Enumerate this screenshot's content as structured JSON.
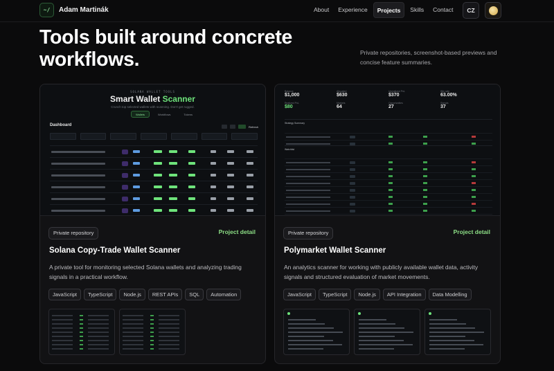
{
  "nav": {
    "logo": "~/",
    "brand": "Adam Martinák",
    "links": [
      "About",
      "Experience",
      "Projects",
      "Skills",
      "Contact"
    ],
    "active": "Projects",
    "lang": "CZ",
    "theme_icon": "moon-icon"
  },
  "hero": {
    "title": "Tools built around concrete workflows.",
    "description": "Private repositories, screenshot-based previews and concise feature summaries."
  },
  "projects": [
    {
      "badge": "Private repository",
      "detail": "Project detail",
      "title": "Solana Copy-Trade Wallet Scanner",
      "description": "A private tool for monitoring selected Solana wallets and analyzing trading signals in a practical workflow.",
      "tags": [
        "JavaScript",
        "TypeScript",
        "Node.js",
        "REST APIs",
        "SQL",
        "Automation"
      ],
      "preview": {
        "kicker": "SOLANA WALLET TOOLS",
        "title_main": "Smart Wallet ",
        "title_accent": "Scanner",
        "subtitle": "Crunch top selected wallets with scanning. Don't get rugged.",
        "tabs": [
          "Wallets",
          "Workflows",
          "Tokens"
        ],
        "dashboard": "Dashboard",
        "refresh": "Refresh"
      }
    },
    {
      "badge": "Private repository",
      "detail": "Project detail",
      "title": "Polymarket Wallet Scanner",
      "description": "An analytics scanner for working with publicly available wallet data, activity signals and structured evaluation of market movements.",
      "tags": [
        "JavaScript",
        "TypeScript",
        "Node.js",
        "API Integration",
        "Data Modelling"
      ],
      "preview": {
        "stats": [
          {
            "label": "Balance",
            "value": "$1,000",
            "green": false
          },
          {
            "label": "Allocated",
            "value": "$630",
            "green": false
          },
          {
            "label": "Unrealized PnL",
            "value": "$370",
            "green": false
          },
          {
            "label": "Win rate",
            "value": "63.00%",
            "green": false
          },
          {
            "label": "Realized PnL",
            "value": "$80",
            "green": true
          },
          {
            "label": "Markets",
            "value": "64",
            "green": false
          },
          {
            "label": "Opportunities",
            "value": "27",
            "green": false
          },
          {
            "label": "Signals",
            "value": "37",
            "green": false
          }
        ],
        "section1": "Strategy Summary",
        "section2": "Watchlist"
      }
    }
  ]
}
